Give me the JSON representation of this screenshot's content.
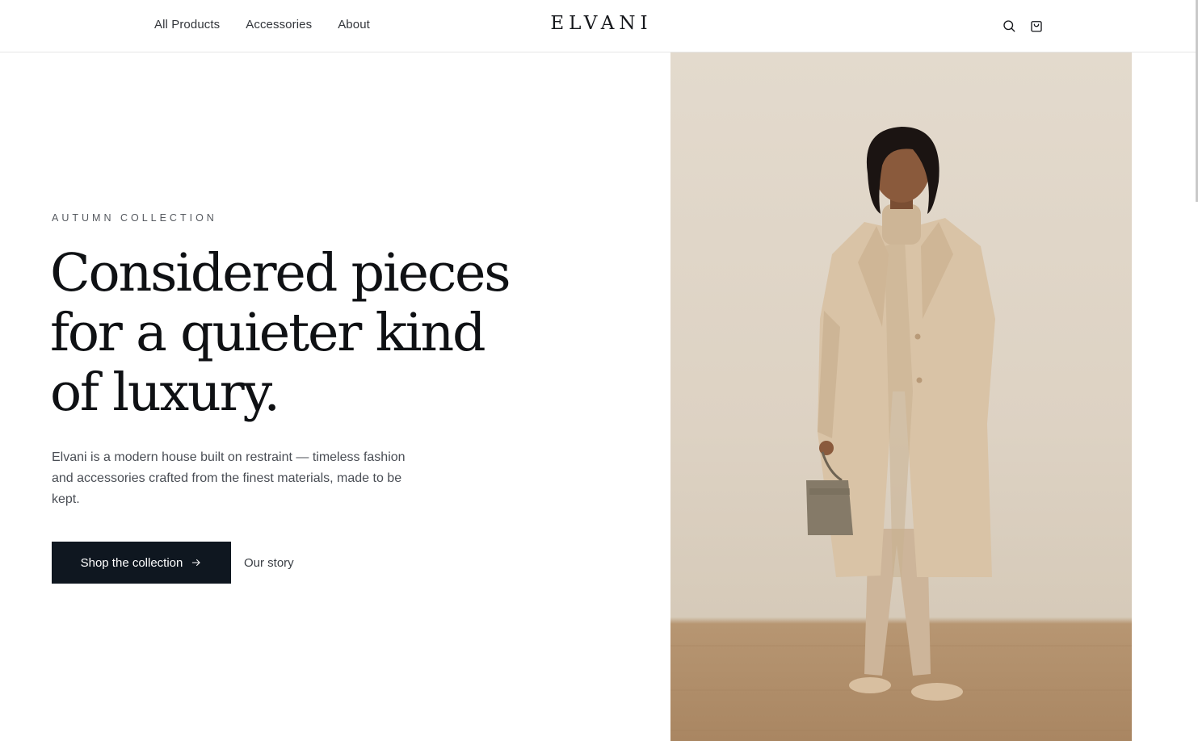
{
  "header": {
    "nav": [
      {
        "label": "All Products"
      },
      {
        "label": "Accessories"
      },
      {
        "label": "About"
      }
    ],
    "logo": "ELVANI",
    "icons": [
      "search-icon",
      "shopping-bag-icon"
    ]
  },
  "hero": {
    "eyebrow": "AUTUMN COLLECTION",
    "headline_lines": [
      "Considered pieces",
      "for a quieter kind",
      "of luxury."
    ],
    "description": "Elvani is a modern house built on restraint — timeless fashion and accessories crafted from the finest materials, made to be kept.",
    "primary_cta": "Shop the collection",
    "secondary_cta": "Our story"
  },
  "colors": {
    "primary_button": "#0f1720",
    "text": "#0f1114",
    "coat": "#d9c3a6",
    "backdrop": "#e3dacd"
  }
}
